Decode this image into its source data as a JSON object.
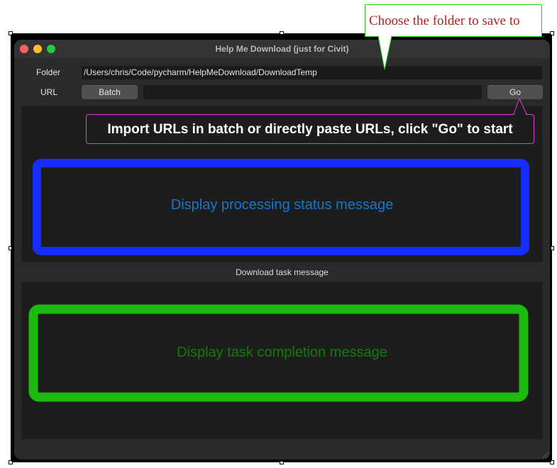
{
  "window": {
    "title": "Help Me Download (just for Civit)",
    "traffic_lights": [
      "#fe5f57",
      "#febc2e",
      "#28c840"
    ]
  },
  "folder": {
    "label": "Folder",
    "value": "/Users/chris/Code/pycharm/HelpMeDownload/DownloadTemp"
  },
  "url": {
    "label": "URL",
    "batch_label": "Batch",
    "value": "",
    "go_label": "Go"
  },
  "status_panel": {
    "message": "Display processing status message",
    "annotation_color": "#1a2dff",
    "text_color": "#1777c9"
  },
  "download": {
    "title": "Download task message",
    "message": "Display task completion message",
    "annotation_color": "#1cba0e",
    "text_color": "#157a0e"
  },
  "annotations": {
    "folder_callout": "Choose the folder to save to",
    "go_callout": "Import URLs in batch or directly paste URLs, click \"Go\" to start",
    "folder_callout_border": "#1fd21f",
    "go_callout_border": "#d940d9"
  }
}
